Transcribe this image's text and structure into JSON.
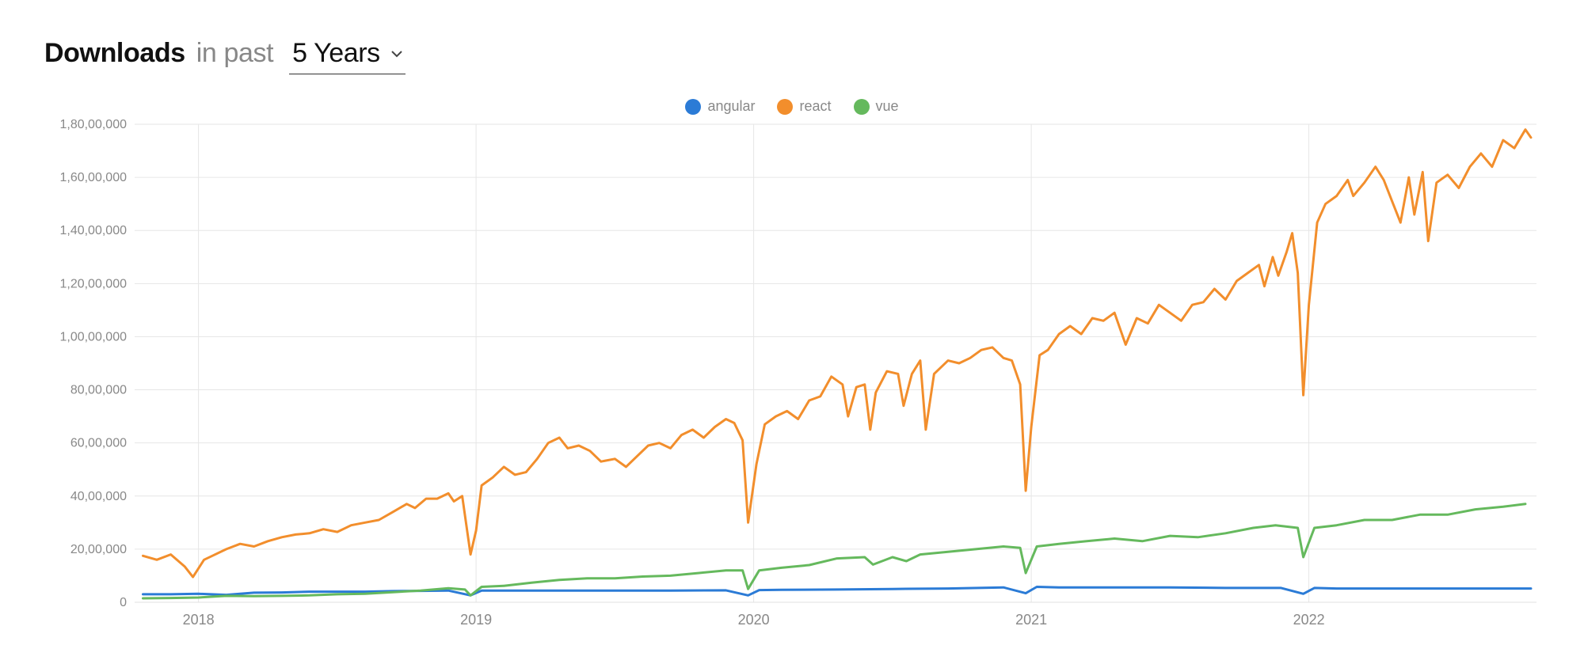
{
  "header": {
    "title": "Downloads",
    "subtitle": "in past",
    "selected": "5 Years"
  },
  "legend": [
    {
      "name": "angular",
      "color": "#2b7bd6"
    },
    {
      "name": "react",
      "color": "#f28e2c"
    },
    {
      "name": "vue",
      "color": "#65b95d"
    }
  ],
  "chart_data": {
    "type": "line",
    "title": "",
    "xlabel": "",
    "ylabel": "",
    "ylim": [
      0,
      18000000
    ],
    "ytick_format": "indian",
    "yticks": [
      0,
      2000000,
      4000000,
      6000000,
      8000000,
      10000000,
      12000000,
      14000000,
      16000000,
      18000000
    ],
    "ytick_labels": [
      "0",
      "20,00,000",
      "40,00,000",
      "60,00,000",
      "80,00,000",
      "1,00,00,000",
      "1,20,00,000",
      "1,40,00,000",
      "1,60,00,000",
      "1,80,00,000"
    ],
    "x_major": [
      2018,
      2019,
      2020,
      2021,
      2022
    ],
    "x_range": [
      2017.77,
      2022.82
    ],
    "series": [
      {
        "name": "angular",
        "color": "#2b7bd6",
        "values": [
          [
            2017.8,
            300000
          ],
          [
            2017.9,
            300000
          ],
          [
            2018.0,
            320000
          ],
          [
            2018.1,
            280000
          ],
          [
            2018.2,
            360000
          ],
          [
            2018.3,
            370000
          ],
          [
            2018.4,
            400000
          ],
          [
            2018.5,
            400000
          ],
          [
            2018.6,
            400000
          ],
          [
            2018.7,
            420000
          ],
          [
            2018.8,
            430000
          ],
          [
            2018.9,
            440000
          ],
          [
            2018.98,
            260000
          ],
          [
            2019.02,
            440000
          ],
          [
            2019.1,
            440000
          ],
          [
            2019.3,
            440000
          ],
          [
            2019.5,
            440000
          ],
          [
            2019.7,
            440000
          ],
          [
            2019.9,
            450000
          ],
          [
            2019.98,
            260000
          ],
          [
            2020.02,
            460000
          ],
          [
            2020.1,
            470000
          ],
          [
            2020.3,
            480000
          ],
          [
            2020.5,
            500000
          ],
          [
            2020.7,
            520000
          ],
          [
            2020.9,
            560000
          ],
          [
            2020.98,
            340000
          ],
          [
            2021.02,
            580000
          ],
          [
            2021.1,
            560000
          ],
          [
            2021.3,
            560000
          ],
          [
            2021.5,
            560000
          ],
          [
            2021.7,
            540000
          ],
          [
            2021.9,
            540000
          ],
          [
            2021.98,
            320000
          ],
          [
            2022.02,
            540000
          ],
          [
            2022.1,
            520000
          ],
          [
            2022.3,
            520000
          ],
          [
            2022.5,
            520000
          ],
          [
            2022.7,
            520000
          ],
          [
            2022.8,
            520000
          ]
        ]
      },
      {
        "name": "react",
        "color": "#f28e2c",
        "values": [
          [
            2017.8,
            1750000
          ],
          [
            2017.85,
            1600000
          ],
          [
            2017.9,
            1800000
          ],
          [
            2017.95,
            1350000
          ],
          [
            2017.98,
            950000
          ],
          [
            2018.02,
            1600000
          ],
          [
            2018.05,
            1750000
          ],
          [
            2018.1,
            2000000
          ],
          [
            2018.15,
            2200000
          ],
          [
            2018.2,
            2100000
          ],
          [
            2018.25,
            2300000
          ],
          [
            2018.3,
            2450000
          ],
          [
            2018.35,
            2550000
          ],
          [
            2018.4,
            2600000
          ],
          [
            2018.45,
            2750000
          ],
          [
            2018.5,
            2650000
          ],
          [
            2018.55,
            2900000
          ],
          [
            2018.6,
            3000000
          ],
          [
            2018.65,
            3100000
          ],
          [
            2018.7,
            3400000
          ],
          [
            2018.75,
            3700000
          ],
          [
            2018.78,
            3550000
          ],
          [
            2018.82,
            3900000
          ],
          [
            2018.86,
            3900000
          ],
          [
            2018.9,
            4100000
          ],
          [
            2018.92,
            3800000
          ],
          [
            2018.95,
            4000000
          ],
          [
            2018.98,
            1800000
          ],
          [
            2019.0,
            2700000
          ],
          [
            2019.02,
            4400000
          ],
          [
            2019.06,
            4700000
          ],
          [
            2019.1,
            5100000
          ],
          [
            2019.14,
            4800000
          ],
          [
            2019.18,
            4900000
          ],
          [
            2019.22,
            5400000
          ],
          [
            2019.26,
            6000000
          ],
          [
            2019.3,
            6200000
          ],
          [
            2019.33,
            5800000
          ],
          [
            2019.37,
            5900000
          ],
          [
            2019.41,
            5700000
          ],
          [
            2019.45,
            5300000
          ],
          [
            2019.5,
            5400000
          ],
          [
            2019.54,
            5100000
          ],
          [
            2019.58,
            5500000
          ],
          [
            2019.62,
            5900000
          ],
          [
            2019.66,
            6000000
          ],
          [
            2019.7,
            5800000
          ],
          [
            2019.74,
            6300000
          ],
          [
            2019.78,
            6500000
          ],
          [
            2019.82,
            6200000
          ],
          [
            2019.86,
            6600000
          ],
          [
            2019.9,
            6900000
          ],
          [
            2019.93,
            6750000
          ],
          [
            2019.96,
            6100000
          ],
          [
            2019.98,
            3000000
          ],
          [
            2020.01,
            5200000
          ],
          [
            2020.04,
            6700000
          ],
          [
            2020.08,
            7000000
          ],
          [
            2020.12,
            7200000
          ],
          [
            2020.16,
            6900000
          ],
          [
            2020.2,
            7600000
          ],
          [
            2020.24,
            7750000
          ],
          [
            2020.28,
            8500000
          ],
          [
            2020.32,
            8200000
          ],
          [
            2020.34,
            7000000
          ],
          [
            2020.37,
            8100000
          ],
          [
            2020.4,
            8200000
          ],
          [
            2020.42,
            6500000
          ],
          [
            2020.44,
            7900000
          ],
          [
            2020.48,
            8700000
          ],
          [
            2020.52,
            8600000
          ],
          [
            2020.54,
            7400000
          ],
          [
            2020.57,
            8600000
          ],
          [
            2020.6,
            9100000
          ],
          [
            2020.62,
            6500000
          ],
          [
            2020.65,
            8600000
          ],
          [
            2020.7,
            9100000
          ],
          [
            2020.74,
            9000000
          ],
          [
            2020.78,
            9200000
          ],
          [
            2020.82,
            9500000
          ],
          [
            2020.86,
            9600000
          ],
          [
            2020.9,
            9200000
          ],
          [
            2020.93,
            9100000
          ],
          [
            2020.96,
            8200000
          ],
          [
            2020.98,
            4200000
          ],
          [
            2021.0,
            6600000
          ],
          [
            2021.03,
            9300000
          ],
          [
            2021.06,
            9500000
          ],
          [
            2021.1,
            10100000
          ],
          [
            2021.14,
            10400000
          ],
          [
            2021.18,
            10100000
          ],
          [
            2021.22,
            10700000
          ],
          [
            2021.26,
            10600000
          ],
          [
            2021.3,
            10900000
          ],
          [
            2021.34,
            9700000
          ],
          [
            2021.38,
            10700000
          ],
          [
            2021.42,
            10500000
          ],
          [
            2021.46,
            11200000
          ],
          [
            2021.5,
            10900000
          ],
          [
            2021.54,
            10600000
          ],
          [
            2021.58,
            11200000
          ],
          [
            2021.62,
            11300000
          ],
          [
            2021.66,
            11800000
          ],
          [
            2021.7,
            11400000
          ],
          [
            2021.74,
            12100000
          ],
          [
            2021.78,
            12400000
          ],
          [
            2021.82,
            12700000
          ],
          [
            2021.84,
            11900000
          ],
          [
            2021.87,
            13000000
          ],
          [
            2021.89,
            12300000
          ],
          [
            2021.92,
            13200000
          ],
          [
            2021.94,
            13900000
          ],
          [
            2021.96,
            12400000
          ],
          [
            2021.98,
            7800000
          ],
          [
            2022.0,
            11200000
          ],
          [
            2022.03,
            14300000
          ],
          [
            2022.06,
            15000000
          ],
          [
            2022.1,
            15300000
          ],
          [
            2022.14,
            15900000
          ],
          [
            2022.16,
            15300000
          ],
          [
            2022.2,
            15800000
          ],
          [
            2022.24,
            16400000
          ],
          [
            2022.27,
            15900000
          ],
          [
            2022.3,
            15100000
          ],
          [
            2022.33,
            14300000
          ],
          [
            2022.36,
            16000000
          ],
          [
            2022.38,
            14600000
          ],
          [
            2022.41,
            16200000
          ],
          [
            2022.43,
            13600000
          ],
          [
            2022.46,
            15800000
          ],
          [
            2022.5,
            16100000
          ],
          [
            2022.54,
            15600000
          ],
          [
            2022.58,
            16400000
          ],
          [
            2022.62,
            16900000
          ],
          [
            2022.66,
            16400000
          ],
          [
            2022.7,
            17400000
          ],
          [
            2022.74,
            17100000
          ],
          [
            2022.78,
            17800000
          ],
          [
            2022.8,
            17500000
          ]
        ]
      },
      {
        "name": "vue",
        "color": "#65b95d",
        "values": [
          [
            2017.8,
            150000
          ],
          [
            2017.9,
            160000
          ],
          [
            2018.0,
            180000
          ],
          [
            2018.1,
            240000
          ],
          [
            2018.2,
            230000
          ],
          [
            2018.3,
            240000
          ],
          [
            2018.4,
            260000
          ],
          [
            2018.5,
            300000
          ],
          [
            2018.6,
            320000
          ],
          [
            2018.7,
            380000
          ],
          [
            2018.8,
            440000
          ],
          [
            2018.9,
            530000
          ],
          [
            2018.96,
            480000
          ],
          [
            2018.98,
            260000
          ],
          [
            2019.02,
            580000
          ],
          [
            2019.1,
            620000
          ],
          [
            2019.2,
            740000
          ],
          [
            2019.3,
            840000
          ],
          [
            2019.4,
            900000
          ],
          [
            2019.5,
            900000
          ],
          [
            2019.6,
            970000
          ],
          [
            2019.7,
            1000000
          ],
          [
            2019.8,
            1100000
          ],
          [
            2019.9,
            1200000
          ],
          [
            2019.96,
            1200000
          ],
          [
            2019.98,
            500000
          ],
          [
            2020.02,
            1200000
          ],
          [
            2020.1,
            1300000
          ],
          [
            2020.2,
            1400000
          ],
          [
            2020.3,
            1650000
          ],
          [
            2020.4,
            1700000
          ],
          [
            2020.43,
            1420000
          ],
          [
            2020.5,
            1700000
          ],
          [
            2020.55,
            1550000
          ],
          [
            2020.6,
            1800000
          ],
          [
            2020.7,
            1900000
          ],
          [
            2020.8,
            2000000
          ],
          [
            2020.9,
            2100000
          ],
          [
            2020.96,
            2050000
          ],
          [
            2020.98,
            1100000
          ],
          [
            2021.02,
            2100000
          ],
          [
            2021.1,
            2200000
          ],
          [
            2021.2,
            2300000
          ],
          [
            2021.3,
            2400000
          ],
          [
            2021.4,
            2300000
          ],
          [
            2021.5,
            2500000
          ],
          [
            2021.6,
            2450000
          ],
          [
            2021.7,
            2600000
          ],
          [
            2021.8,
            2800000
          ],
          [
            2021.88,
            2900000
          ],
          [
            2021.96,
            2800000
          ],
          [
            2021.98,
            1700000
          ],
          [
            2022.02,
            2800000
          ],
          [
            2022.1,
            2900000
          ],
          [
            2022.2,
            3100000
          ],
          [
            2022.3,
            3100000
          ],
          [
            2022.4,
            3300000
          ],
          [
            2022.5,
            3300000
          ],
          [
            2022.6,
            3500000
          ],
          [
            2022.7,
            3600000
          ],
          [
            2022.78,
            3700000
          ]
        ]
      }
    ]
  }
}
